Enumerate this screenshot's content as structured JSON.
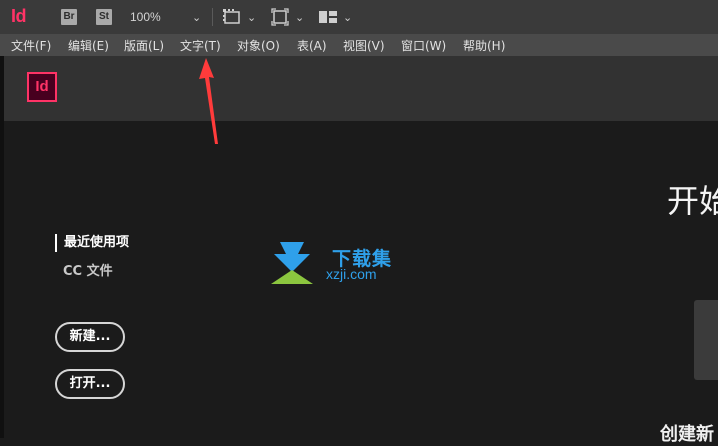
{
  "appbar": {
    "app_logo": "Id",
    "bridge_button": "Br",
    "stock_button": "St",
    "zoom_level": "100%",
    "icons": [
      "chevron-down-icon",
      "view-options-icon",
      "screen-mode-icon",
      "arrange-documents-icon"
    ]
  },
  "menu": {
    "items": [
      "文件(F)",
      "编辑(E)",
      "版面(L)",
      "文字(T)",
      "对象(O)",
      "表(A)",
      "视图(V)",
      "窗口(W)",
      "帮助(H)"
    ]
  },
  "welcome": {
    "logo": "Id",
    "heading": "开始",
    "nav": {
      "recent": "最近使用项",
      "cc_files": "CC 文件"
    },
    "new_button": "新建...",
    "open_button": "打开...",
    "create_new": "创建新"
  },
  "watermark": {
    "cn": "下载集",
    "en": "xzji.com"
  },
  "colors": {
    "indesign_pink": "#ff3366",
    "annotation_arrow": "#ff3b3b",
    "watermark_blue": "#2fa0ea",
    "watermark_green": "#8cc63f"
  }
}
